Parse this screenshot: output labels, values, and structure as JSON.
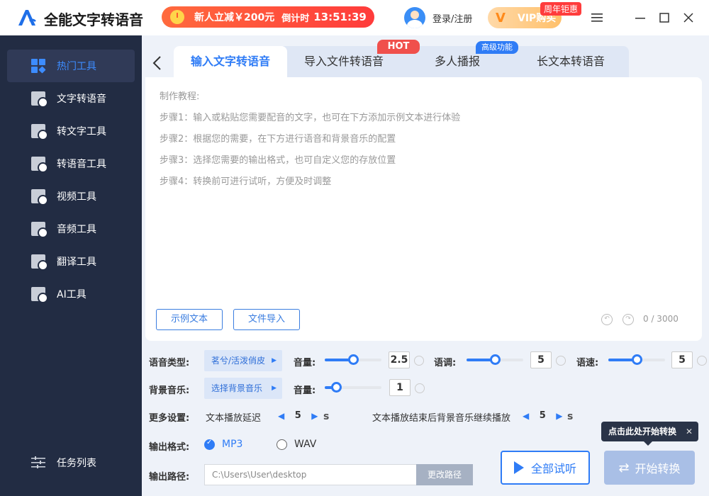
{
  "app": {
    "title": "全能文字转语音"
  },
  "promo": {
    "text": "新人立减￥200元",
    "countdown_label": "倒计时",
    "countdown": "13:51:39"
  },
  "user": {
    "login_label": "登录/注册"
  },
  "vip": {
    "label": "VIP购买",
    "badge": "周年钜惠"
  },
  "sidebar": {
    "items": [
      {
        "label": "热门工具",
        "icon": "hot-tools-icon",
        "active": true
      },
      {
        "label": "文字转语音",
        "icon": "text-to-speech-icon"
      },
      {
        "label": "转文字工具",
        "icon": "to-text-icon"
      },
      {
        "label": "转语音工具",
        "icon": "to-speech-icon"
      },
      {
        "label": "视频工具",
        "icon": "video-icon"
      },
      {
        "label": "音频工具",
        "icon": "audio-icon"
      },
      {
        "label": "翻译工具",
        "icon": "translate-icon"
      },
      {
        "label": "AI工具",
        "icon": "ai-icon"
      }
    ],
    "task_list": "任务列表"
  },
  "tabs": [
    {
      "label": "输入文字转语音",
      "active": true
    },
    {
      "label": "导入文件转语音",
      "badge": "HOT"
    },
    {
      "label": "多人播报",
      "badge": "高级功能"
    },
    {
      "label": "长文本转语音"
    }
  ],
  "editor": {
    "tutorial_title": "制作教程:",
    "steps": [
      "步骤1：输入或粘贴您需要配音的文字，也可在下方添加示例文本进行体验",
      "步骤2：根据您的需要，在下方进行语音和背景音乐的配置",
      "步骤3：选择您需要的输出格式，也可自定义您的存放位置",
      "步骤4：转换前可进行试听，方便及时调整"
    ],
    "sample_button": "示例文本",
    "import_button": "文件导入",
    "counter": "0 / 3000"
  },
  "settings": {
    "voice_type_label": "语音类型:",
    "voice_type_value": "茗兮/活泼俏皮",
    "volume_label": "音量:",
    "volume_value": "2.5",
    "volume_level": 0.5,
    "pitch_label": "语调:",
    "pitch_value": "5",
    "pitch_level": 0.5,
    "speed_label": "语速:",
    "speed_value": "5",
    "speed_level": 0.5,
    "bgm_label": "背景音乐:",
    "bgm_value": "选择背景音乐",
    "bgm_volume_label": "音量:",
    "bgm_volume_value": "1",
    "bgm_volume_level": 0.2,
    "more_label": "更多设置:",
    "delay_label": "文本播放延迟",
    "delay_value": "5",
    "delay_unit": "s",
    "bgm_continue_label": "文本播放结束后背景音乐继续播放",
    "bgm_continue_value": "5",
    "bgm_continue_unit": "s",
    "format_label": "输出格式:",
    "format_options": [
      "MP3",
      "WAV"
    ],
    "format_selected": "MP3",
    "path_label": "输出路径:",
    "path_value": "C:\\Users\\User\\desktop",
    "change_path_button": "更改路径"
  },
  "actions": {
    "preview_button": "全部试听",
    "start_button": "开始转换",
    "tooltip": "点击此处开始转换"
  }
}
